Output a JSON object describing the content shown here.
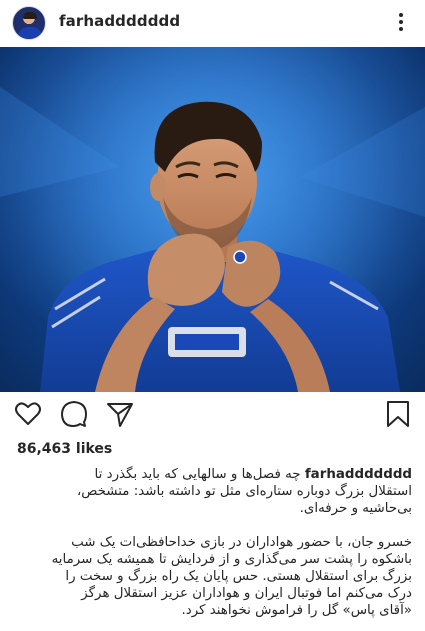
{
  "post": {
    "username": "farhaddddddd",
    "likes_text": "86,463 likes"
  },
  "icons": {
    "avatar": "profile-avatar",
    "more": "more-options-icon",
    "like": "heart-icon",
    "comment": "comment-icon",
    "share": "share-icon",
    "save": "bookmark-icon"
  },
  "caption": {
    "lines1": [
      "چه فصل‌ها و سالهایی که باید بگذرد تا",
      "استقلال بزرگ دوباره ستاره‌ای مثل تو داشته باشد: متشخص،",
      "بی‌حاشیه و حرفه‌ای."
    ],
    "lines2": [
      "خسرو جان، با حضور هواداران در بازی خداحافظی‌ات یک شب",
      "باشکوه را پشت سر می‌گذاری و از فردایش تا همیشه یک سرمایه",
      "بزرگ برای استقلال هستی. حس پایان یک راه بزرگ و سخت را",
      "درک می‌کنم اما فوتبال ایران و هواداران عزیز استقلال هرگز",
      "«آقای پاس» گل را فراموش نخواهند کرد."
    ]
  },
  "colors": {
    "text": "#262626",
    "shirt": "#1a48b8",
    "background_blue": "#1b5fb5"
  }
}
